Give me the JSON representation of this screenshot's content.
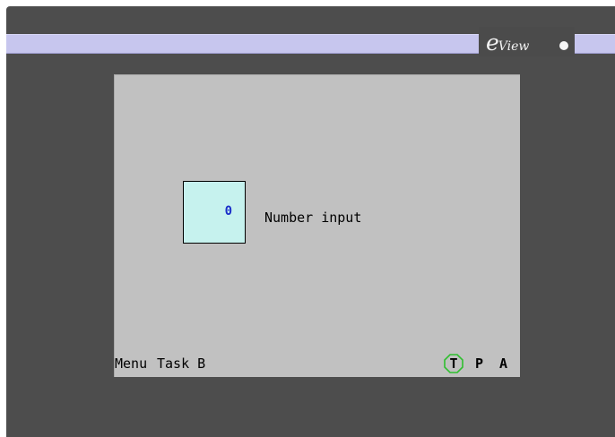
{
  "device": {
    "brand_mark": "e",
    "brand_name": "View",
    "led_icon": "power-led-icon",
    "colors": {
      "bezel": "#4d4d4d",
      "band": "#c7c6ee",
      "screen": "#c1c1c1",
      "input_box": "#c6f2ee",
      "value_text": "#1b2fc9",
      "status_ring": "#2fbf2f"
    }
  },
  "screen": {
    "number_input": {
      "value": "0",
      "label": "Number input"
    },
    "footer": {
      "menu_label": "Menu",
      "task_label": "Task B",
      "status": {
        "t": "T",
        "p": "P",
        "a": "A"
      }
    }
  }
}
